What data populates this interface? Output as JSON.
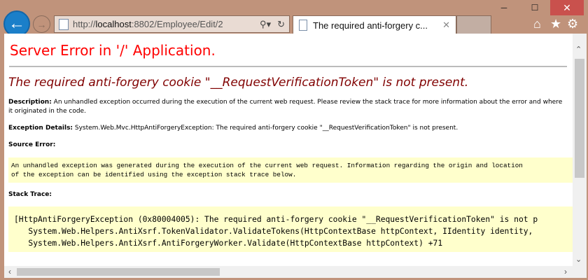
{
  "browser": {
    "url_prefix": "http://",
    "url_host": "localhost",
    "url_rest": ":8802/Employee/Edit/2",
    "tab_title": "The required anti-forgery c...",
    "icons": [
      "back-icon",
      "forward-icon",
      "search-icon",
      "refresh-icon",
      "home-icon",
      "star-icon",
      "gear-icon"
    ]
  },
  "page": {
    "title": "Server Error in '/' Application.",
    "error_heading": "The required anti-forgery cookie \"__RequestVerificationToken\" is not present.",
    "description_label": "Description:",
    "description_text": " An unhandled exception occurred during the execution of the current web request. Please review the stack trace for more information about the error and where it originated in the code.",
    "exception_label": "Exception Details:",
    "exception_text": " System.Web.Mvc.HttpAntiForgeryException: The required anti-forgery cookie \"__RequestVerificationToken\" is not present.",
    "source_error_label": "Source Error:",
    "source_error_line1": "An unhandled exception was generated during the execution of the current web request. Information regarding the origin and location",
    "source_error_line2": "of the exception can be identified using the exception stack trace below.",
    "stack_trace_label": "Stack Trace:",
    "stack_lines": [
      "[HttpAntiForgeryException (0x80004005): The required anti-forgery cookie \"__RequestVerificationToken\" is not p",
      "   System.Web.Helpers.AntiXsrf.TokenValidator.ValidateTokens(HttpContextBase httpContext, IIdentity identity,",
      "   System.Web.Helpers.AntiXsrf.AntiForgeryWorker.Validate(HttpContextBase httpContext) +71"
    ]
  }
}
